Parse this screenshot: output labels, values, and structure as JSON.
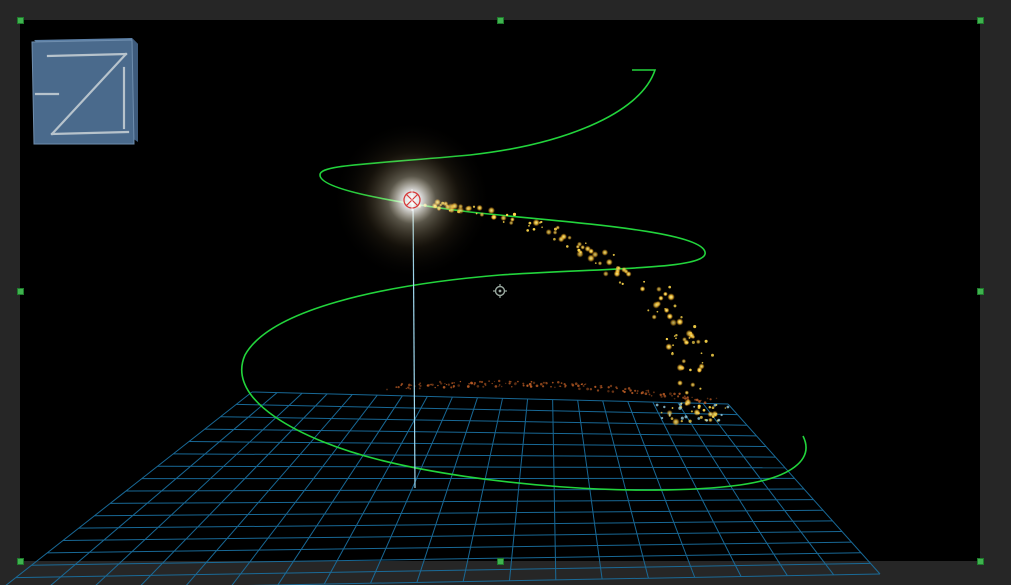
{
  "colors": {
    "app_background": "#262626",
    "viewport_background": "#000000",
    "grid_line": "#1a6e9e",
    "motion_path": "#22d43c",
    "light_stem": "#9fd8ee",
    "particle_core": "#ffd84a",
    "particle_trail": "#d86a2a",
    "selection_handle": "#3fb34f",
    "view_cube_face": "#4a6a8c",
    "view_cube_edge": "#b7c3cc"
  },
  "view_cube": {
    "label": "Z",
    "icon": "view-cube-icon"
  },
  "icons": {
    "light": "point-light-icon",
    "target": "target-crosshair-icon",
    "handle": "selection-handle-icon"
  }
}
